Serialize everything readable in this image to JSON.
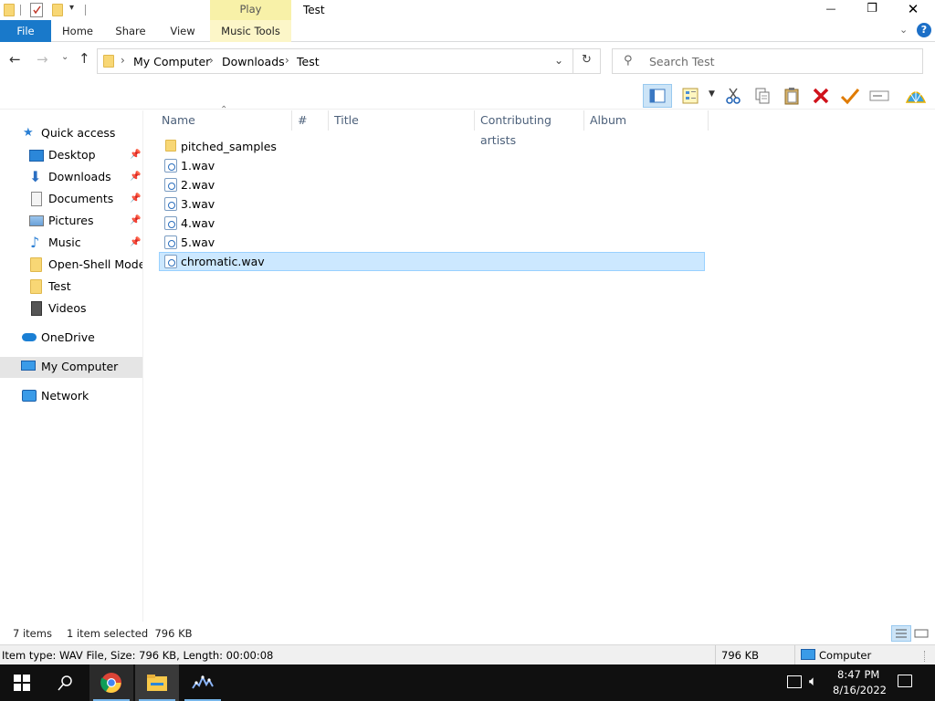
{
  "window": {
    "title": "Test",
    "context_group": "Play",
    "controls": {
      "minimize": "—",
      "maximize": "❐",
      "close": "✕"
    }
  },
  "ribbon": {
    "tabs": [
      {
        "label": "File"
      },
      {
        "label": "Home"
      },
      {
        "label": "Share"
      },
      {
        "label": "View"
      },
      {
        "label": "Music Tools"
      }
    ],
    "help": "?"
  },
  "address": {
    "crumbs": [
      "My Computer",
      "Downloads",
      "Test"
    ],
    "search_placeholder": "Search Test"
  },
  "nav": {
    "quick_access": "Quick access",
    "items": [
      {
        "label": "Desktop",
        "pinned": true
      },
      {
        "label": "Downloads",
        "pinned": true
      },
      {
        "label": "Documents",
        "pinned": true
      },
      {
        "label": "Pictures",
        "pinned": true
      },
      {
        "label": "Music",
        "pinned": true
      },
      {
        "label": "Open-Shell Modern",
        "pinned": false
      },
      {
        "label": "Test",
        "pinned": false
      },
      {
        "label": "Videos",
        "pinned": false
      }
    ],
    "onedrive": "OneDrive",
    "my_computer": "My Computer",
    "network": "Network"
  },
  "columns": [
    "Name",
    "#",
    "Title",
    "Contributing artists",
    "Album"
  ],
  "files": [
    {
      "name": "pitched_samples",
      "type": "folder",
      "selected": false
    },
    {
      "name": "1.wav",
      "type": "wav",
      "selected": false
    },
    {
      "name": "2.wav",
      "type": "wav",
      "selected": false
    },
    {
      "name": "3.wav",
      "type": "wav",
      "selected": false
    },
    {
      "name": "4.wav",
      "type": "wav",
      "selected": false
    },
    {
      "name": "5.wav",
      "type": "wav",
      "selected": false
    },
    {
      "name": "chromatic.wav",
      "type": "wav",
      "selected": true
    }
  ],
  "status": {
    "count": "7 items",
    "selection": "1 item selected  796 KB",
    "details": "Item type: WAV File, Size: 796 KB, Length: 00:00:08",
    "size": "796 KB",
    "location": "Computer"
  },
  "taskbar": {
    "time": "8:47 PM",
    "date": "8/16/2022"
  },
  "colors": {
    "accent": "#1979ca",
    "selection": "#cce8ff",
    "folder": "#f8d775"
  }
}
